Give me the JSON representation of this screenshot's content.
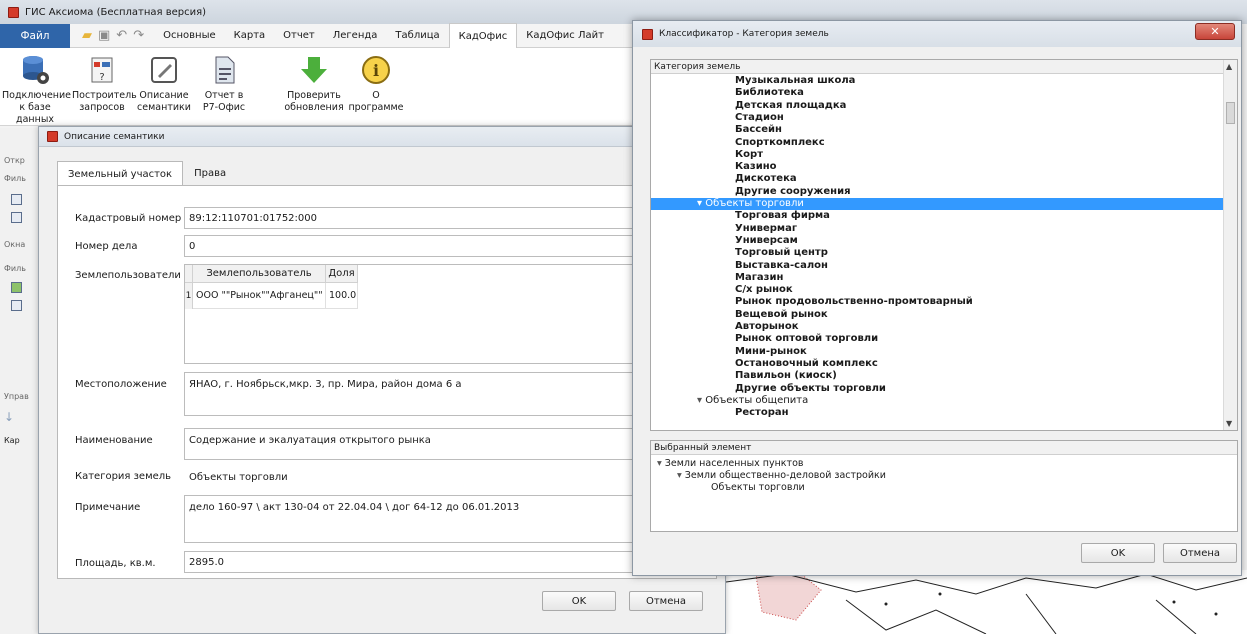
{
  "main": {
    "title": "ГИС Аксиома (Бесплатная версия)",
    "file_menu": "Файл",
    "tabs": [
      "Основные",
      "Карта",
      "Отчет",
      "Легенда",
      "Таблица",
      "КадОфис",
      "КадОфис Лайт"
    ],
    "active_tab": "КадОфис",
    "ribbon": [
      {
        "label": "Подключение к базе данных",
        "icon": "database-gear-icon"
      },
      {
        "label": "Построитель запросов",
        "icon": "query-builder-icon"
      },
      {
        "label": "Описание семантики",
        "icon": "edit-pen-icon"
      },
      {
        "label": "Отчет в Р7-Офис",
        "icon": "report-document-icon"
      },
      {
        "label": "Проверить обновления",
        "icon": "download-arrow-icon"
      },
      {
        "label": "О программе",
        "icon": "info-icon"
      }
    ],
    "sidebar": {
      "open_label": "Откр",
      "filter1": "Филь",
      "windows_label": "Окна",
      "filter2": "Филь",
      "manage_label": "Управ",
      "tree_label": "Кар"
    }
  },
  "desc": {
    "title": "Описание семантики",
    "tabs": [
      "Земельный участок",
      "Права"
    ],
    "fields": {
      "cadastral_label": "Кадастровый номер",
      "cadastral_value": "89:12:110701:01752:000",
      "case_label": "Номер дела",
      "case_value": "0",
      "users_label": "Землепользователи",
      "location_label": "Местоположение",
      "location_value": "ЯНАО, г. Ноябрьск,мкр. 3, пр. Мира, район дома 6 а",
      "name_label": "Наименование",
      "name_value": "Содержание и экалуатация открытого рынка",
      "category_label": "Категория земель",
      "category_value": "Объекты торговли",
      "note_label": "Примечание",
      "note_value": "дело 160-97 \\ акт 130-04 от 22.04.04 \\ дог 64-12 до 06.01.2013",
      "area_label": "Площадь, кв.м.",
      "area_value": "2895.0"
    },
    "grid": {
      "headers": [
        "Землепользователь",
        "Доля"
      ],
      "rows": [
        {
          "num": "1",
          "user": "ООО \"\"Рынок\"\"Афганец\"\"",
          "share": "100.0"
        }
      ]
    },
    "ok": "OK",
    "cancel": "Отмена"
  },
  "cls": {
    "title": "Классификатор - Категория земель",
    "tree_header": "Категория земель",
    "tree": [
      {
        "t": "Музыкальная школа",
        "lvl": 2
      },
      {
        "t": "Библиотека",
        "lvl": 2
      },
      {
        "t": "Детская площадка",
        "lvl": 2
      },
      {
        "t": "Стадион",
        "lvl": 2
      },
      {
        "t": "Бассейн",
        "lvl": 2
      },
      {
        "t": "Спорткомплекс",
        "lvl": 2
      },
      {
        "t": "Корт",
        "lvl": 2
      },
      {
        "t": "Казино",
        "lvl": 2
      },
      {
        "t": "Дискотека",
        "lvl": 2
      },
      {
        "t": "Другие сооружения",
        "lvl": 2
      },
      {
        "t": "Объекты торговли",
        "lvl": 1,
        "sel": true
      },
      {
        "t": "Торговая фирма",
        "lvl": 2
      },
      {
        "t": "Универмаг",
        "lvl": 2
      },
      {
        "t": "Универсам",
        "lvl": 2
      },
      {
        "t": "Торговый центр",
        "lvl": 2
      },
      {
        "t": "Выставка-салон",
        "lvl": 2
      },
      {
        "t": "Магазин",
        "lvl": 2
      },
      {
        "t": "С/х рынок",
        "lvl": 2
      },
      {
        "t": "Рынок продовольственно-промтоварный",
        "lvl": 2
      },
      {
        "t": "Вещевой рынок",
        "lvl": 2
      },
      {
        "t": "Авторынок",
        "lvl": 2
      },
      {
        "t": "Рынок оптовой торговли",
        "lvl": 2
      },
      {
        "t": "Мини-рынок",
        "lvl": 2
      },
      {
        "t": "Остановочный комплекс",
        "lvl": 2
      },
      {
        "t": "Павильон (киоск)",
        "lvl": 2
      },
      {
        "t": "Другие объекты торговли",
        "lvl": 2
      },
      {
        "t": "Объекты общепита",
        "lvl": 1
      },
      {
        "t": "Ресторан",
        "lvl": 2
      }
    ],
    "selected_header": "Выбранный элемент",
    "selected": [
      {
        "t": "Земли населенных пунктов",
        "lvl": 0
      },
      {
        "t": "Земли общественно-деловой застройки",
        "lvl": 1
      },
      {
        "t": "Объекты торговли",
        "lvl": 2
      }
    ],
    "ok": "OK",
    "cancel": "Отмена"
  },
  "colors": {
    "accent": "#2f65a9",
    "selection": "#3399ff"
  }
}
